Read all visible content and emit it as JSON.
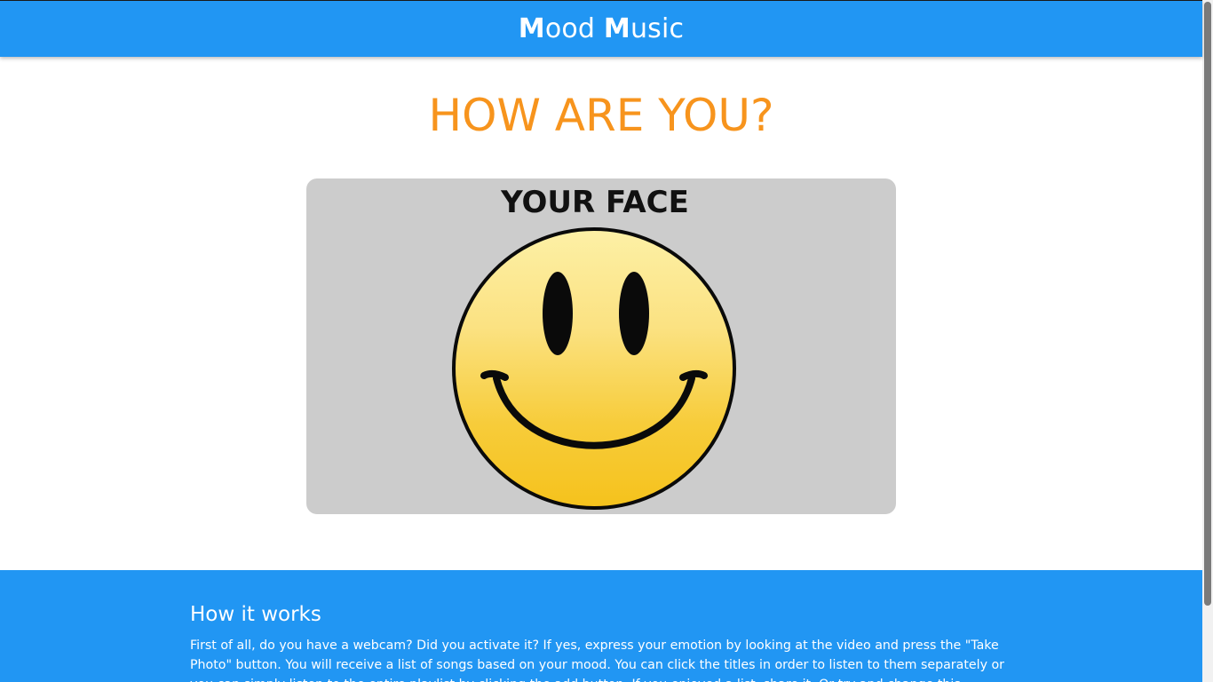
{
  "navbar": {
    "brand_first_cap": "M",
    "brand_first_rest": "ood ",
    "brand_second_cap": "M",
    "brand_second_rest": "usic"
  },
  "main": {
    "headline": "HOW ARE YOU?",
    "face_card": {
      "title": "YOUR FACE",
      "image": "smiley-face-icon"
    }
  },
  "footer": {
    "title": "How it works",
    "text": "First of all, do you have a webcam? Did you activate it? If yes, express your emotion by looking at the video and press the \"Take Photo\" button. You will receive a list of songs based on your mood. You can click the titles in order to listen to them separately or you can simply listen to the entire playlist by clicking the add button. If you enjoyed a list, share it. Or try and change this experience with your friends!"
  },
  "colors": {
    "primary": "#2196f3",
    "accent": "#f7941d",
    "card_background": "#cccccc"
  }
}
